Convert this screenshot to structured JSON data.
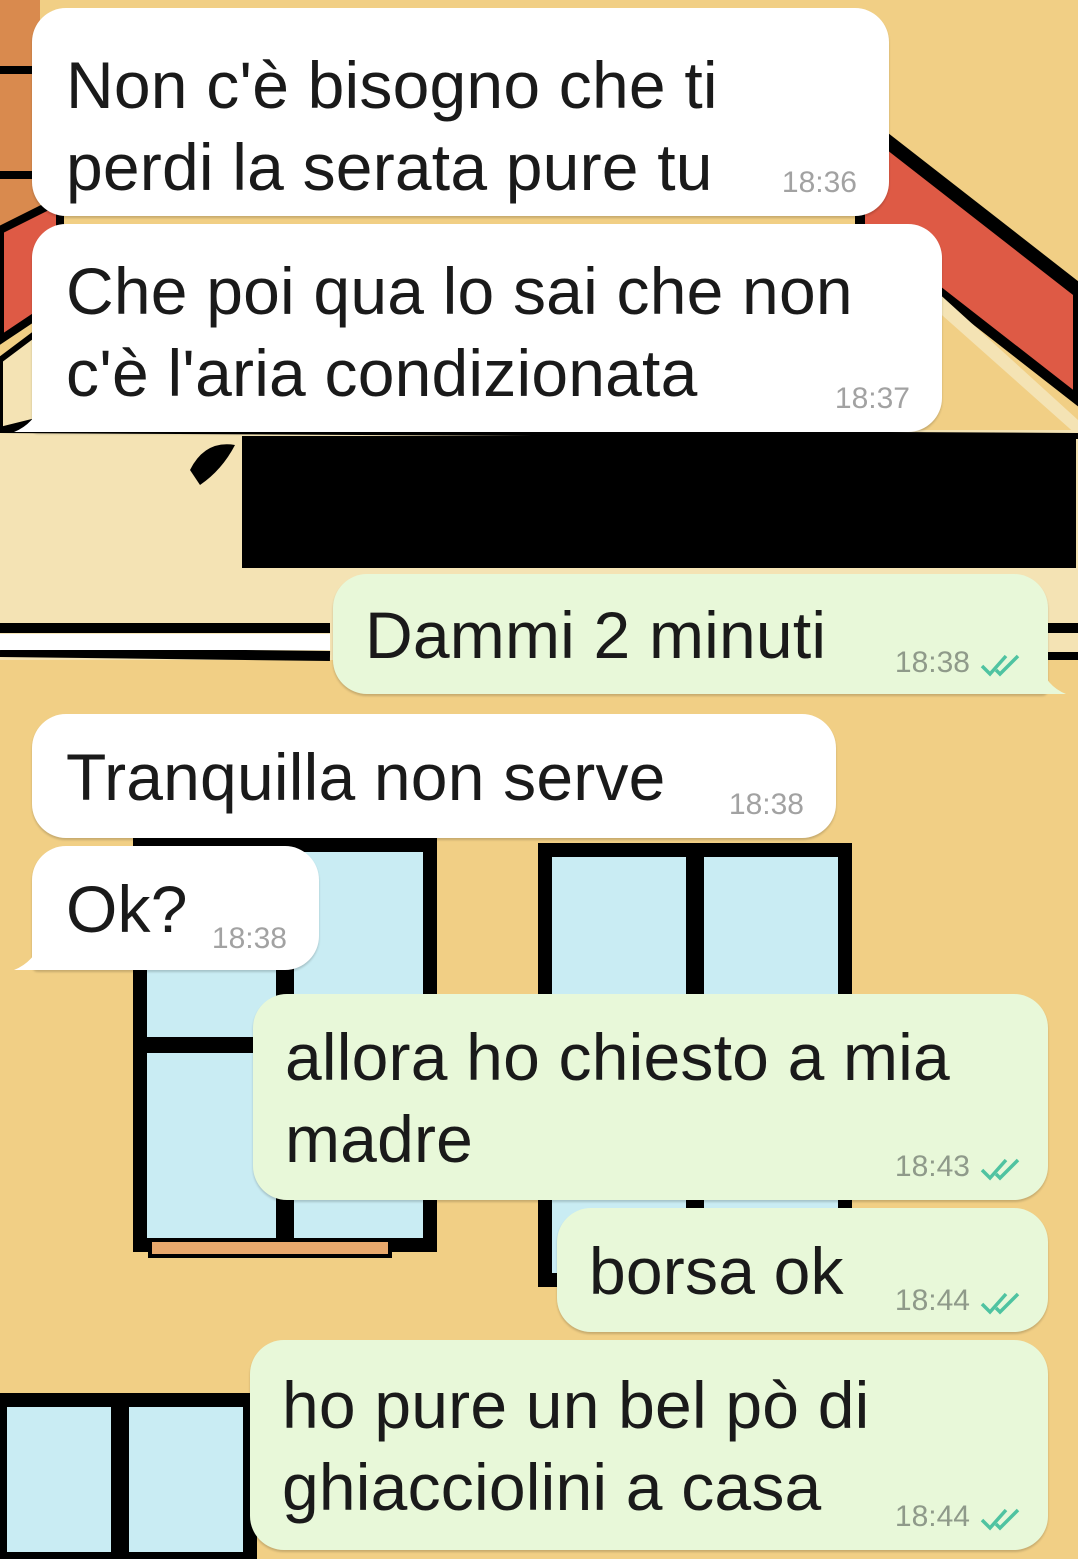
{
  "colors": {
    "wallpaper": "#f1cf85",
    "incoming_bubble": "#ffffff",
    "outgoing_bubble": "#e8f8d9",
    "read_ticks": "#4fc3a1",
    "redaction": "#000000"
  },
  "messages": [
    {
      "direction": "incoming",
      "text": "Non c'è bisogno che ti\nperdi la serata pure tu",
      "time": "18:36"
    },
    {
      "direction": "incoming",
      "text": "Che poi qua lo sai che non\nc'è l'aria condizionata",
      "time": "18:37"
    },
    {
      "direction": "outgoing",
      "text": "Dammi 2 minuti",
      "time": "18:38",
      "status": "read-double-check-icon"
    },
    {
      "direction": "incoming",
      "text": "Tranquilla non serve",
      "time": "18:38"
    },
    {
      "direction": "incoming",
      "text": "Ok?",
      "time": "18:38"
    },
    {
      "direction": "outgoing",
      "text": "allora ho chiesto a mia\nmadre",
      "time": "18:43",
      "status": "read-double-check-icon"
    },
    {
      "direction": "outgoing",
      "text": "borsa ok",
      "time": "18:44",
      "status": "read-double-check-icon"
    },
    {
      "direction": "outgoing",
      "text": "ho pure un bel pò di\nghiacciolini a casa",
      "time": "18:44",
      "status": "read-double-check-icon"
    }
  ]
}
